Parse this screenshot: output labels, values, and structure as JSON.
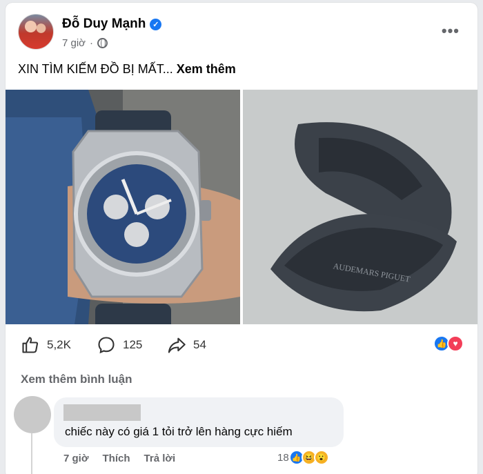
{
  "post": {
    "author": "Đỗ Duy Mạnh",
    "time": "7 giờ",
    "text": "XIN TÌM KIẾM ĐỒ BỊ MẤT...",
    "see_more": "Xem thêm",
    "photo_watermark": "AUDEMARS PIGUET"
  },
  "stats": {
    "likes": "5,2K",
    "comments": "125",
    "shares": "54"
  },
  "comments_section": {
    "view_more": "Xem thêm bình luận",
    "comment": {
      "text": "chiếc này có giá 1 tỏi trở lên hàng cực hiếm",
      "time": "7 giờ",
      "like_label": "Thích",
      "reply_label": "Trả lời",
      "reaction_count": "18"
    }
  },
  "colors": {
    "accent": "#1877f2",
    "love": "#f33e58",
    "haha": "#f7b125"
  }
}
